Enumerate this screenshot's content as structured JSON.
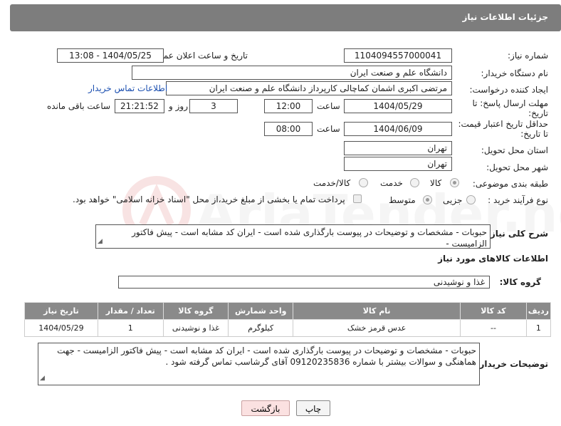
{
  "header": {
    "title": "جزئیات اطلاعات نیاز"
  },
  "fields": {
    "need_number_label": "شماره نیاز:",
    "need_number": "1104094557000041",
    "announce_label": "تاریخ و ساعت اعلان عمومی:",
    "announce_value": "1404/05/25 - 13:08",
    "buyer_org_label": "نام دستگاه خریدار:",
    "buyer_org": "دانشگاه علم و صنعت ایران",
    "creator_label": "ایجاد کننده درخواست:",
    "creator": "مرتضی اکبری اشمان کماچالی کارپرداز دانشگاه علم و صنعت ایران",
    "contact_link": "اطلاعات تماس خریدار",
    "deadline_label_1": "مهلت ارسال پاسخ: تا",
    "deadline_label_2": "تاریخ:",
    "deadline_date": "1404/05/29",
    "time_label": "ساعت",
    "deadline_time": "12:00",
    "days_value": "3",
    "days_label": "روز و",
    "remaining_time": "21:21:52",
    "remaining_label": "ساعت باقی مانده",
    "validity_label_1": "حداقل تاریخ اعتبار قیمت:",
    "validity_label_2": "تا تاریخ:",
    "validity_date": "1404/06/09",
    "validity_time": "08:00",
    "province_label": "استان محل تحویل:",
    "province": "تهران",
    "city_label": "شهر محل تحویل:",
    "city": "تهران",
    "category_label": "طبقه بندی موضوعی:",
    "category_options": [
      "کالا",
      "خدمت",
      "کالا/خدمت"
    ],
    "category_selected": "کالا",
    "process_label": "نوع فرآیند خرید :",
    "process_options": [
      "جزیی",
      "متوسط"
    ],
    "process_selected": "متوسط",
    "payment_note": "پرداخت تمام یا بخشی از مبلغ خرید،از محل \"اسناد خزانه اسلامی\" خواهد بود."
  },
  "description": {
    "label": "شرح کلی نیاز:",
    "text": "حبوبات - مشخصات و توضیحات در پیوست بارگذاری شده است - ایران کد مشابه است - پیش فاکتور الزامیست -"
  },
  "goods": {
    "section_title": "اطلاعات کالاهای مورد نیاز",
    "group_label": "گروه کالا:",
    "group_value": "غذا و نوشیدنی"
  },
  "table": {
    "headers": [
      "ردیف",
      "کد کالا",
      "نام کالا",
      "واحد شمارش",
      "گروه کالا",
      "تعداد / مقدار",
      "تاریخ نیاز"
    ],
    "rows": [
      [
        "1",
        "--",
        "عدس قرمز خشک",
        "کیلوگرم",
        "غذا و نوشیدنی",
        "1",
        "1404/05/29"
      ]
    ]
  },
  "buyer_notes": {
    "label": "توضیحات خریدار:",
    "text": "حبوبات - مشخصات و توضیحات در پیوست بارگذاری شده است - ایران کد مشابه است - پیش فاکتور الزامیست - جهت هماهنگی و سوالات بیشتر با شماره 09120235836 آقای گرشاسب تماس گرفته شود ."
  },
  "buttons": {
    "print": "چاپ",
    "back": "بازگشت"
  },
  "watermark": "AriaTender.net"
}
